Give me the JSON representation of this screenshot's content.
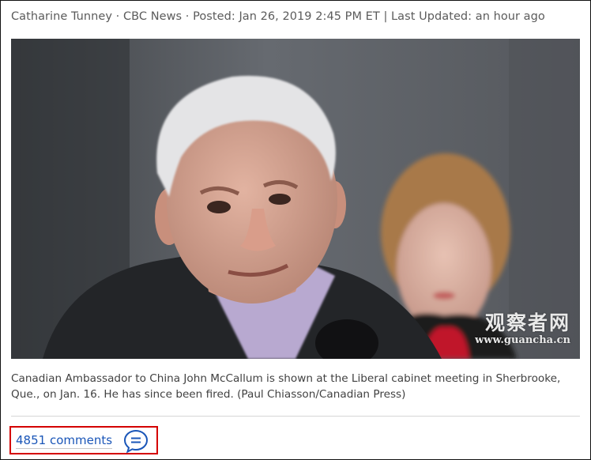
{
  "article": {
    "byline": "Catharine Tunney · CBC News · Posted: Jan 26, 2019 2:45 PM ET | Last Updated: an hour ago",
    "photo_watermark": {
      "chinese": "观察者网",
      "url": "www.guancha.cn"
    },
    "caption": "Canadian Ambassador to China John McCallum is shown at the Liberal cabinet meeting in Sherbrooke, Que., on Jan. 16. He has since been fired. (Paul Chiasson/Canadian Press)"
  },
  "comments": {
    "label": "4851 comments",
    "icon": "speech-bubble-icon"
  },
  "colors": {
    "link": "#1a56b8",
    "highlight_border": "#d40000",
    "text": "#414141"
  }
}
